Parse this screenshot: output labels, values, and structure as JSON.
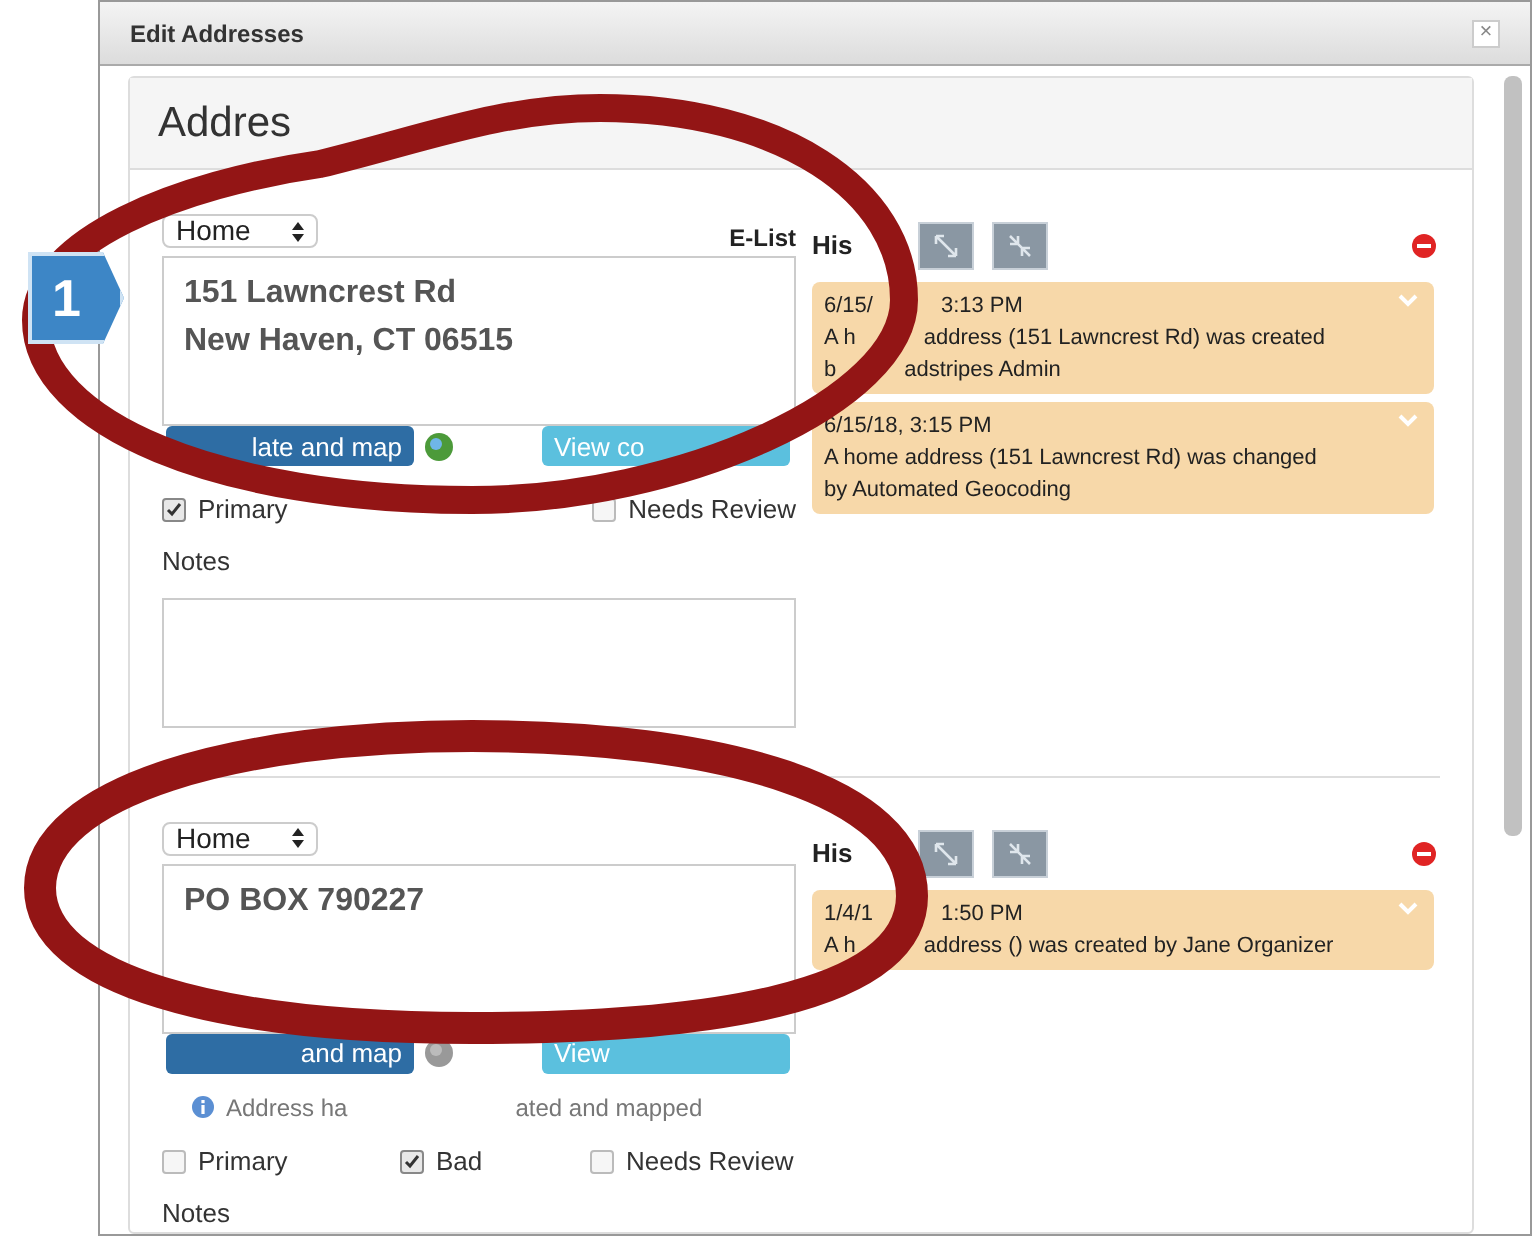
{
  "window": {
    "title": "Edit Addresses",
    "close": "×"
  },
  "callout": {
    "label": "1"
  },
  "panel": {
    "heading": "Addres"
  },
  "addresses": [
    {
      "type": "Home",
      "elist": "E-List",
      "value": "151 Lawncrest Rd\nNew Haven, CT 06515",
      "map_button": "late and map",
      "geocoded": true,
      "view_button": "View co",
      "checks": [
        {
          "label": "Primary",
          "checked": true
        },
        {
          "label": "Needs Review",
          "checked": false,
          "kind": "right"
        }
      ],
      "notes_label": "Notes",
      "notes_field": true,
      "history_label": "His",
      "history": [
        {
          "lines": [
            [
              "6/15/",
              "3:13 PM"
            ],
            [
              "A h",
              "address (151 Lawncrest Rd) was created"
            ],
            [
              "b",
              "adstripes Admin"
            ]
          ]
        },
        {
          "lines": [
            [
              "6/15/18, 3:15 PM"
            ],
            [
              "A home address (151 Lawncrest Rd) was changed"
            ],
            [
              "by Automated Geocoding"
            ]
          ]
        }
      ]
    },
    {
      "type": "Home",
      "value": "PO BOX 790227",
      "map_button": "and map",
      "geocoded": false,
      "view_button": "View",
      "info": [
        "Address ha",
        "ated and mapped"
      ],
      "checks": [
        {
          "label": "Primary",
          "checked": false
        },
        {
          "label": "Bad",
          "checked": true
        },
        {
          "label": "Needs Review",
          "checked": false
        }
      ],
      "notes_label": "Notes",
      "history_label": "His",
      "history": [
        {
          "lines": [
            [
              "1/4/1",
              "1:50 PM"
            ],
            [
              "A h",
              "address () was created by Jane Organizer"
            ]
          ]
        }
      ]
    }
  ]
}
